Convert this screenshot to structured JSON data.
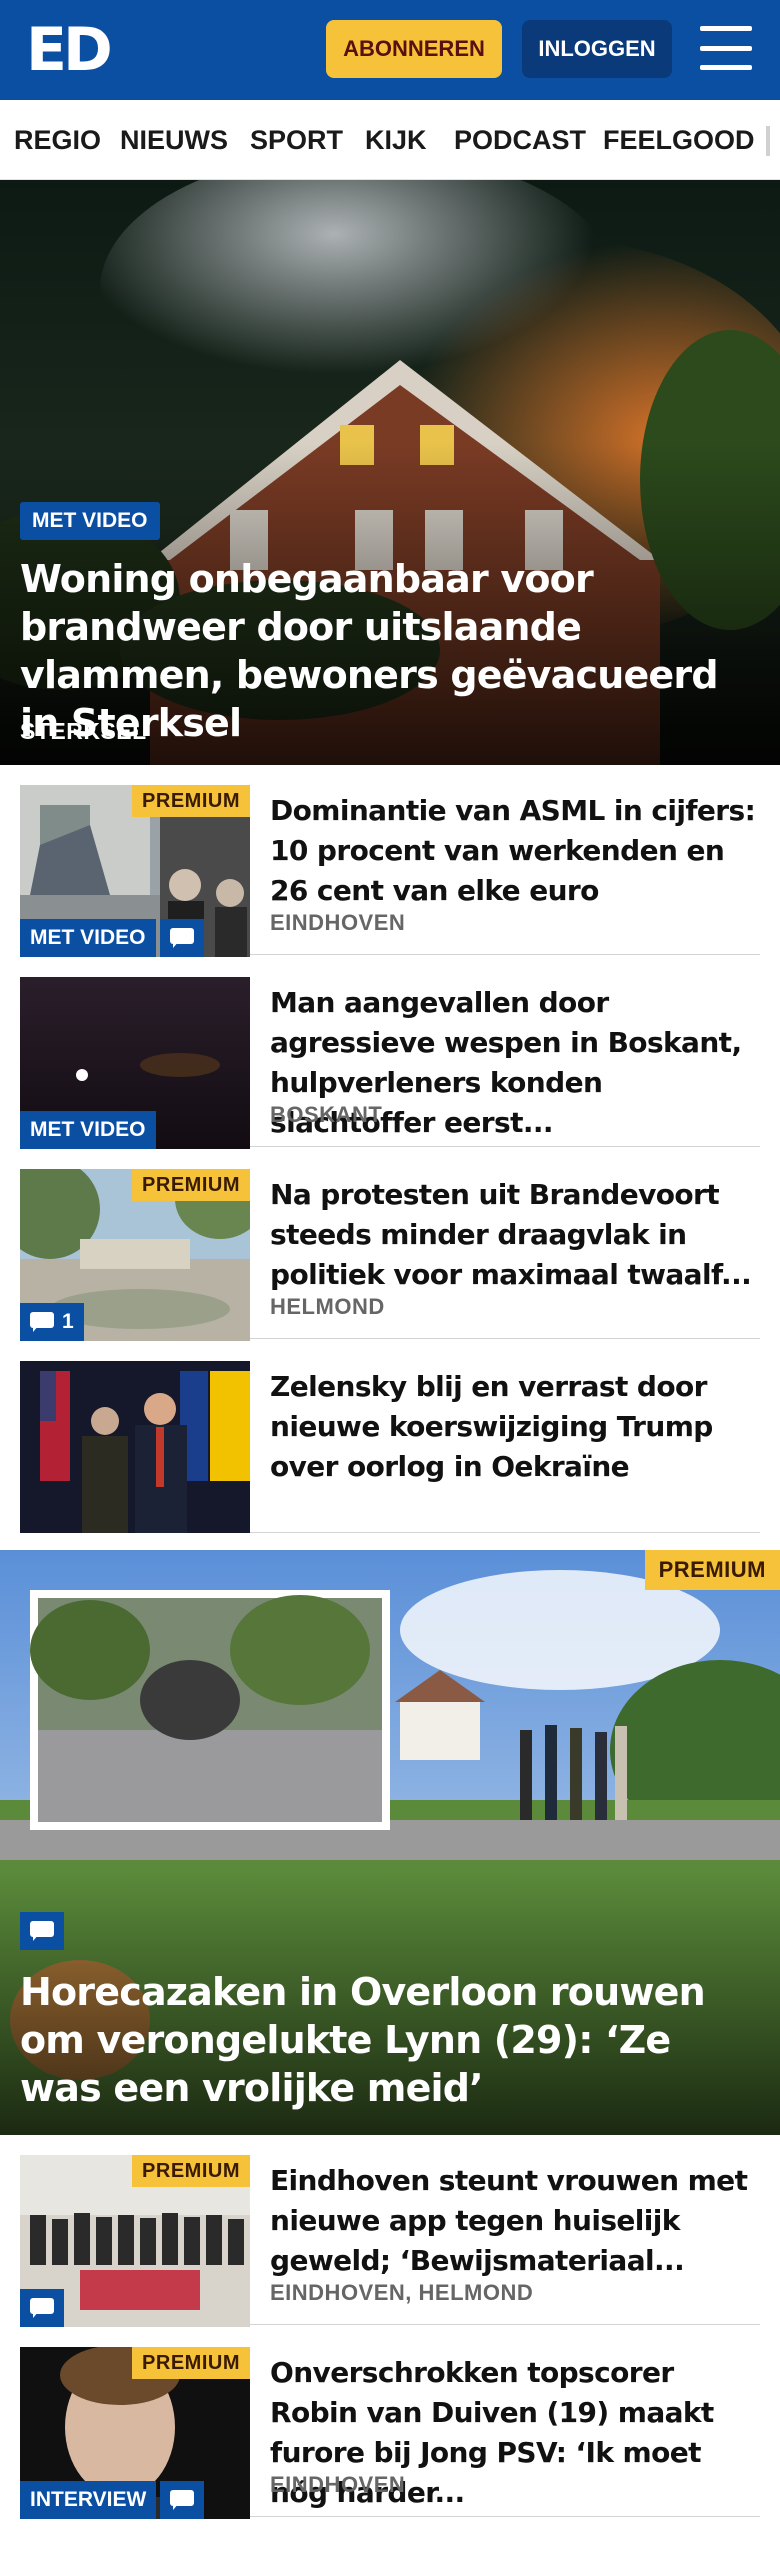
{
  "header": {
    "logo": "ED",
    "subscribe_label": "ABONNEREN",
    "login_label": "INLOGGEN"
  },
  "nav": {
    "items": [
      "REGIO",
      "NIEUWS",
      "SPORT",
      "KIJK",
      "PODCAST",
      "FEELGOOD"
    ]
  },
  "hero": {
    "tag": "MET VIDEO",
    "title": "Woning onbegaanbaar voor brandweer door uitslaande vlammen, bewoners geëvacueerd in Sterksel",
    "location": "STERKSEL"
  },
  "articles": [
    {
      "premium": "PREMIUM",
      "tag": "MET VIDEO",
      "title": "Dominantie van ASML in cijfers: 10 procent van werkenden en 26 cent van elke euro",
      "location": "EINDHOVEN"
    },
    {
      "tag": "MET VIDEO",
      "title": "Man aangevallen door agressieve wespen in Boskant, hulpverle­ners konden slachtoffer eerst...",
      "location": "BOSKANT"
    },
    {
      "premium": "PREMIUM",
      "comments": "1",
      "title": "Na protesten uit Brandevoort steeds minder draagvlak in politiek voor maximaal twaalf...",
      "location": "HELMOND"
    },
    {
      "title": "Zelensky blij en verrast door nieuwe koerswijziging Trump over oorlog in Oekraïne",
      "location": ""
    }
  ],
  "hero2": {
    "premium": "PREMIUM",
    "title": "Horecazaken in Overloon rouwen om verongelukte Lynn (29): ‘Ze was een vrolijke meid’"
  },
  "articles2": [
    {
      "premium": "PREMIUM",
      "title": "Eindhoven steunt vrouwen met nieuwe app tegen huiselijk geweld; ‘Bewijsmateriaal...",
      "location": "EINDHOVEN, HELMOND"
    },
    {
      "premium": "PREMIUM",
      "tag": "INTERVIEW",
      "title": "Onverschrokken topscorer Robin van Duiven (19) maakt furore bij Jong PSV: ‘Ik moet nóg harder...",
      "location": "EINDHOVEN"
    }
  ]
}
